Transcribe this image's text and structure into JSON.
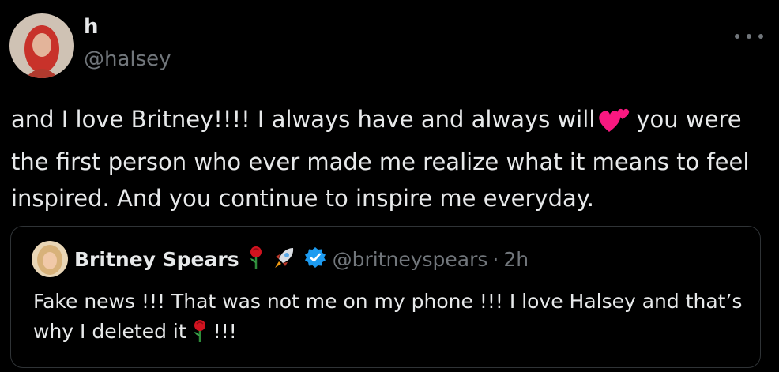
{
  "tweet": {
    "display_name": "h",
    "handle": "@halsey",
    "more_icon": "more-horizontal-icon",
    "text_part1": "and I love Britney!!!! I always have and always will",
    "text_emoji": "two-hearts-icon",
    "text_part2": "you were the first person who ever made me realize what it means to feel inspired. And you continue to inspire me everyday."
  },
  "quoted_tweet": {
    "display_name": "Britney Spears",
    "name_icons": [
      "rose-icon",
      "rocket-icon",
      "verified-badge-icon"
    ],
    "handle": "@britneyspears",
    "separator": "·",
    "time": "2h",
    "text_part1": "Fake news !!! That was not me on my phone !!! I love Halsey and that’s why I deleted it",
    "text_emoji": "rose-icon",
    "text_part2": "!!!"
  },
  "colors": {
    "background": "#000000",
    "text_primary": "#e7e9ea",
    "text_secondary": "#71767b",
    "border": "#2f3336",
    "verified_blue": "#1d9bf0",
    "heart_pink": "#f91880"
  }
}
